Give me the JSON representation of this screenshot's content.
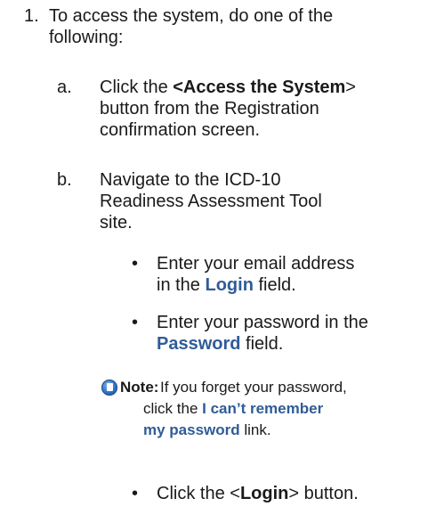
{
  "step1": {
    "number": "1.",
    "line1": "To access the system, do one of the",
    "line2": "following:"
  },
  "option_a": {
    "letter": "a.",
    "line1_prefix": "Click the ",
    "line1_bold": "<Access the System",
    "line1_suffix": ">",
    "line2": "button from the Registration",
    "line3": "confirmation screen."
  },
  "option_b": {
    "letter": "b.",
    "line1": "Navigate to the ICD-10",
    "line2": "Readiness Assessment Tool",
    "line3": "site."
  },
  "bullets": {
    "dot": "•",
    "email": {
      "line1": "Enter your email address",
      "line2_prefix": "in the ",
      "line2_field": "Login",
      "line2_suffix": " field."
    },
    "password": {
      "line1": "Enter your password in the",
      "line2_field": "Password",
      "line2_suffix": " field."
    },
    "login": {
      "prefix": "Click the <",
      "bold": "Login",
      "suffix": "> button."
    }
  },
  "note": {
    "label": "Note:",
    "line1": " If you forget your password,",
    "line2_prefix": "click the ",
    "line2_link": "I can’t remember",
    "line3_link": "my password",
    "line3_suffix": " link."
  }
}
